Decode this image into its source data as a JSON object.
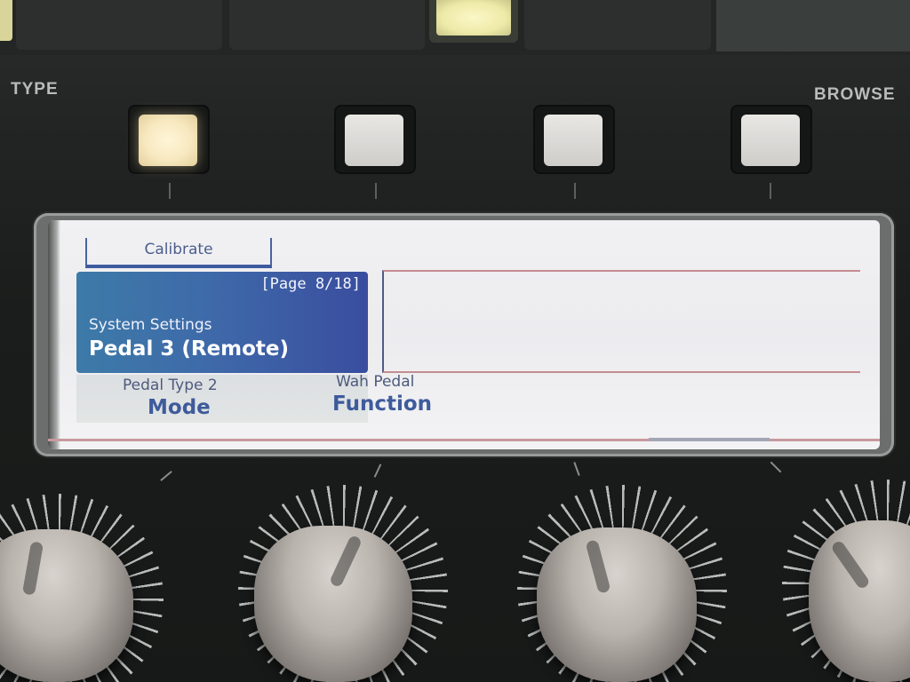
{
  "device": {
    "labels": {
      "type": "TYPE",
      "browse": "BROWSE"
    }
  },
  "display": {
    "tab_label": "Calibrate",
    "page_indicator": "[Page 8/18]",
    "section": "System Settings",
    "item": "Pedal 3 (Remote)",
    "params": [
      {
        "value": "Pedal Type 2",
        "name": "Mode"
      },
      {
        "value": "Wah Pedal",
        "name": "Function"
      }
    ]
  },
  "colors": {
    "lcd_background": "#efeff1",
    "info_box_blue": "#3e6aa9",
    "param_text": "#3e5b9b",
    "lit_button": "#f7e8bf"
  }
}
